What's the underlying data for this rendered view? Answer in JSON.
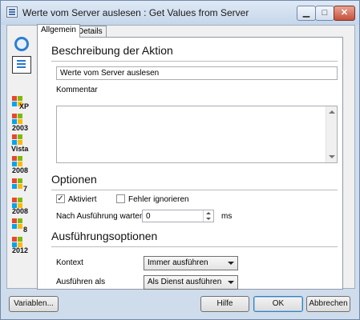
{
  "window": {
    "title": "Werte vom Server auslesen : Get Values from Server"
  },
  "sidebar": {
    "top_icons": [
      "circle-action-icon",
      "document-list-icon"
    ],
    "os_items": [
      {
        "label": "XP"
      },
      {
        "label": "2003"
      },
      {
        "label": "Vista"
      },
      {
        "label": "2008"
      },
      {
        "label": "7"
      },
      {
        "label": "2008"
      },
      {
        "label": "8"
      },
      {
        "label": "2012"
      }
    ]
  },
  "tabs": [
    {
      "label": "Allgemein",
      "active": true
    },
    {
      "label": "Details",
      "active": false
    }
  ],
  "description": {
    "heading": "Beschreibung der Aktion",
    "name_value": "Werte vom Server auslesen",
    "comment_label": "Kommentar",
    "comment_value": ""
  },
  "options": {
    "heading": "Optionen",
    "activated": {
      "label": "Aktiviert",
      "checked": true
    },
    "ignore_errors": {
      "label": "Fehler ignorieren",
      "checked": false
    },
    "wait_label": "Nach Ausführung warten",
    "wait_value": "0",
    "wait_unit": "ms"
  },
  "execution": {
    "heading": "Ausführungsoptionen",
    "context_label": "Kontext",
    "context_value": "Immer ausführen",
    "run_as_label": "Ausführen als",
    "run_as_value": "Als Dienst ausführen"
  },
  "footer": {
    "variables_label": "Variablen...",
    "help_label": "Hilfe",
    "ok_label": "OK",
    "cancel_label": "Abbrechen"
  },
  "colors": {
    "accent": "#2d7fd0",
    "close_button": "#c4503a"
  }
}
